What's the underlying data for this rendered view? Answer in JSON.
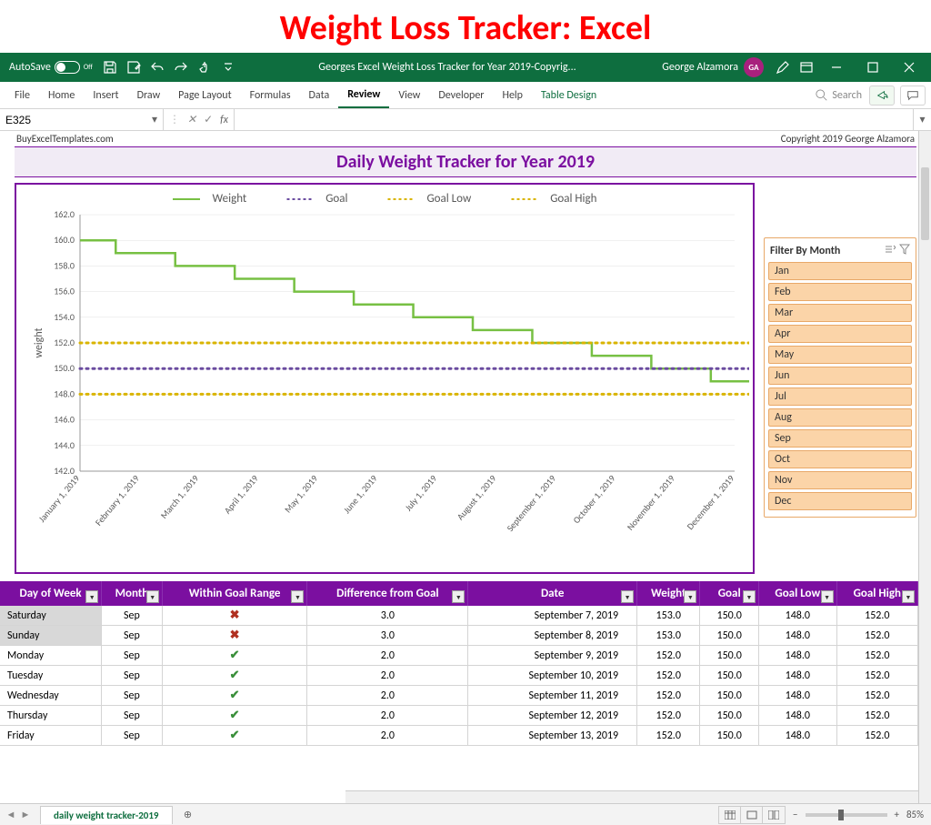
{
  "page_title": "Weight Loss Tracker: Excel",
  "titlebar": {
    "autosave_label": "AutoSave",
    "autosave_state": "Off",
    "document_title": "Georges Excel Weight Loss Tracker for Year 2019-Copyrig...",
    "user_name": "George Alzamora",
    "user_initials": "GA"
  },
  "ribbon": {
    "tabs": [
      "File",
      "Home",
      "Insert",
      "Draw",
      "Page Layout",
      "Formulas",
      "Data",
      "Review",
      "View",
      "Developer",
      "Help",
      "Table Design"
    ],
    "active_tab": "Review",
    "context_tab": "Table Design",
    "search_placeholder": "Search"
  },
  "formula_bar": {
    "cell_ref": "E325",
    "formula_value": ""
  },
  "sheet_header": {
    "left": "BuyExcelTemplates.com",
    "right": "Copyright 2019  George Alzamora"
  },
  "chart_title": "Daily Weight Tracker for Year 2019",
  "legend": {
    "weight": "Weight",
    "goal": "Goal",
    "goal_low": "Goal Low",
    "goal_high": "Goal High"
  },
  "chart_data": {
    "type": "line",
    "xlabel": "",
    "ylabel": "weight",
    "ylim": [
      142,
      162
    ],
    "yticks": [
      142,
      144,
      146,
      148,
      150,
      152,
      154,
      156,
      158,
      160,
      162
    ],
    "categories": [
      "January 1, 2019",
      "February 1, 2019",
      "March 1, 2019",
      "April 1, 2019",
      "May 1, 2019",
      "June 1, 2019",
      "July 1, 2019",
      "August 1, 2019",
      "September 1, 2019",
      "October 1, 2019",
      "November 1, 2019",
      "December 1, 2019"
    ],
    "series": [
      {
        "name": "Weight",
        "color": "#77c043",
        "style": "solid",
        "values": [
          160,
          159,
          158,
          157,
          156,
          155,
          154,
          153,
          152,
          151,
          150,
          149
        ]
      },
      {
        "name": "Goal",
        "color": "#6b4ca0",
        "style": "dotted",
        "values": [
          150,
          150,
          150,
          150,
          150,
          150,
          150,
          150,
          150,
          150,
          150,
          150
        ]
      },
      {
        "name": "Goal Low",
        "color": "#d9b400",
        "style": "dotted",
        "values": [
          148,
          148,
          148,
          148,
          148,
          148,
          148,
          148,
          148,
          148,
          148,
          148
        ]
      },
      {
        "name": "Goal High",
        "color": "#d9b400",
        "style": "dotted",
        "values": [
          152,
          152,
          152,
          152,
          152,
          152,
          152,
          152,
          152,
          152,
          152,
          152
        ]
      }
    ]
  },
  "slicer": {
    "title": "Filter By Month",
    "items": [
      "Jan",
      "Feb",
      "Mar",
      "Apr",
      "May",
      "Jun",
      "Jul",
      "Aug",
      "Sep",
      "Oct",
      "Nov",
      "Dec"
    ]
  },
  "table": {
    "columns": [
      "Day of Week",
      "Month",
      "Within Goal Range",
      "Difference from Goal",
      "Date",
      "Weight",
      "Goal",
      "Goal Low",
      "Goal High"
    ],
    "rows": [
      {
        "dow": "Saturday",
        "month": "Sep",
        "within": false,
        "diff": "3.0",
        "date": "September 7, 2019",
        "weight": "153.0",
        "goal": "150.0",
        "goal_low": "148.0",
        "goal_high": "152.0",
        "hl": true
      },
      {
        "dow": "Sunday",
        "month": "Sep",
        "within": false,
        "diff": "3.0",
        "date": "September 8, 2019",
        "weight": "153.0",
        "goal": "150.0",
        "goal_low": "148.0",
        "goal_high": "152.0",
        "hl": true
      },
      {
        "dow": "Monday",
        "month": "Sep",
        "within": true,
        "diff": "2.0",
        "date": "September 9, 2019",
        "weight": "152.0",
        "goal": "150.0",
        "goal_low": "148.0",
        "goal_high": "152.0"
      },
      {
        "dow": "Tuesday",
        "month": "Sep",
        "within": true,
        "diff": "2.0",
        "date": "September 10, 2019",
        "weight": "152.0",
        "goal": "150.0",
        "goal_low": "148.0",
        "goal_high": "152.0"
      },
      {
        "dow": "Wednesday",
        "month": "Sep",
        "within": true,
        "diff": "2.0",
        "date": "September 11, 2019",
        "weight": "152.0",
        "goal": "150.0",
        "goal_low": "148.0",
        "goal_high": "152.0"
      },
      {
        "dow": "Thursday",
        "month": "Sep",
        "within": true,
        "diff": "2.0",
        "date": "September 12, 2019",
        "weight": "152.0",
        "goal": "150.0",
        "goal_low": "148.0",
        "goal_high": "152.0"
      },
      {
        "dow": "Friday",
        "month": "Sep",
        "within": true,
        "diff": "2.0",
        "date": "September 13, 2019",
        "weight": "152.0",
        "goal": "150.0",
        "goal_low": "148.0",
        "goal_high": "152.0"
      }
    ]
  },
  "sheet_tabs": {
    "active": "daily weight tracker-2019"
  },
  "status_bar": {
    "zoom": "85%"
  }
}
